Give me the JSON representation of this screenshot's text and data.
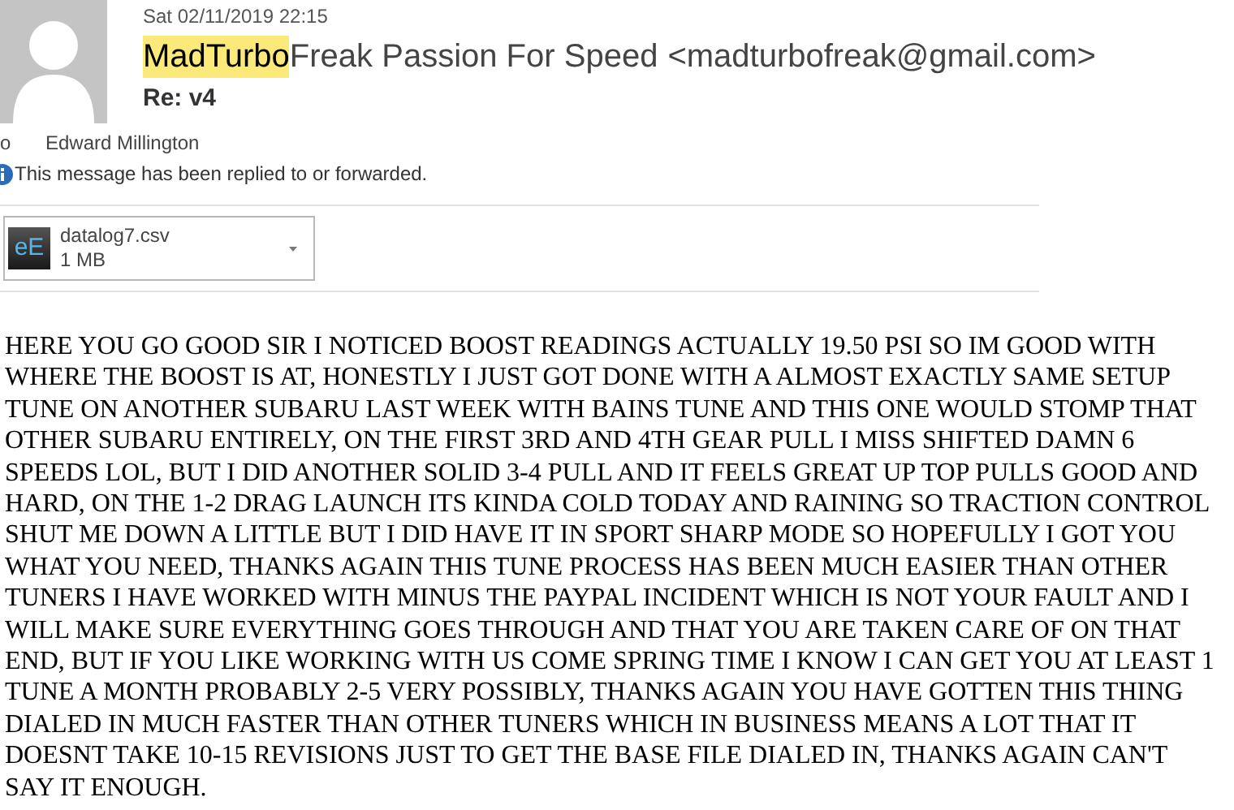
{
  "header": {
    "date": "Sat 02/11/2019 22:15",
    "sender_highlighted": "MadTurbo",
    "sender_rest": "Freak Passion For Speed",
    "sender_email": "<madturbofreak@gmail.com>",
    "subject": "Re: v4",
    "to_label": "o",
    "to_name": "Edward Millington",
    "info": "This message has been replied to or forwarded."
  },
  "attachment": {
    "name": "datalog7.csv",
    "size": "1 MB",
    "icon_text": "eE"
  },
  "body": "HERE YOU GO GOOD SIR I NOTICED BOOST READINGS ACTUALLY 19.50 PSI SO IM GOOD WITH WHERE THE BOOST IS AT, HONESTLY I JUST GOT DONE WITH A ALMOST EXACTLY SAME SETUP TUNE ON ANOTHER SUBARU LAST WEEK WITH BAINS TUNE AND THIS ONE WOULD STOMP THAT OTHER SUBARU ENTIRELY, ON THE FIRST 3RD AND 4TH GEAR PULL I MISS SHIFTED DAMN 6 SPEEDS LOL, BUT I DID ANOTHER SOLID 3-4 PULL AND IT FEELS GREAT UP TOP PULLS GOOD AND HARD, ON THE 1-2 DRAG LAUNCH ITS KINDA COLD TODAY AND RAINING SO TRACTION CONTROL SHUT ME DOWN A LITTLE BUT I DID HAVE IT IN SPORT SHARP MODE SO HOPEFULLY I GOT YOU WHAT YOU NEED, THANKS AGAIN THIS TUNE PROCESS HAS BEEN MUCH EASIER THAN OTHER TUNERS I HAVE WORKED WITH MINUS THE PAYPAL INCIDENT WHICH IS NOT YOUR FAULT AND I WILL MAKE SURE EVERYTHING GOES THROUGH AND THAT YOU ARE TAKEN CARE OF ON THAT END, BUT IF YOU LIKE WORKING WITH US COME SPRING TIME I KNOW I CAN GET YOU AT LEAST 1 TUNE A MONTH PROBABLY 2-5 VERY POSSIBLY, THANKS AGAIN YOU HAVE GOTTEN THIS THING DIALED IN MUCH FASTER THAN OTHER TUNERS WHICH IN BUSINESS MEANS A LOT THAT IT DOESNT TAKE 10-15 REVISIONS JUST TO GET THE BASE FILE DIALED IN, THANKS AGAIN CAN'T SAY IT ENOUGH."
}
